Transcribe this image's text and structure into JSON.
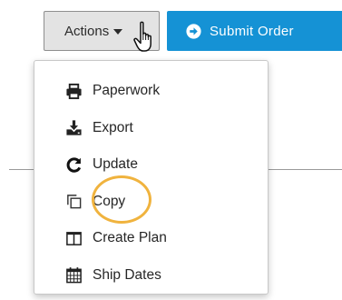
{
  "toolbar": {
    "actions_label": "Actions",
    "submit_label": "Submit Order",
    "submit_color": "#1592d5",
    "actions_bg": "#e3e3e3"
  },
  "menu": {
    "items": [
      {
        "label": "Paperwork",
        "icon": "printer-icon"
      },
      {
        "label": "Export",
        "icon": "download-icon"
      },
      {
        "label": "Update",
        "icon": "refresh-icon"
      },
      {
        "label": "Copy",
        "icon": "copy-icon"
      },
      {
        "label": "Create Plan",
        "icon": "columns-icon"
      },
      {
        "label": "Ship Dates",
        "icon": "calendar-icon"
      }
    ]
  },
  "highlight": {
    "target": "Copy",
    "color": "#f0b33e"
  }
}
